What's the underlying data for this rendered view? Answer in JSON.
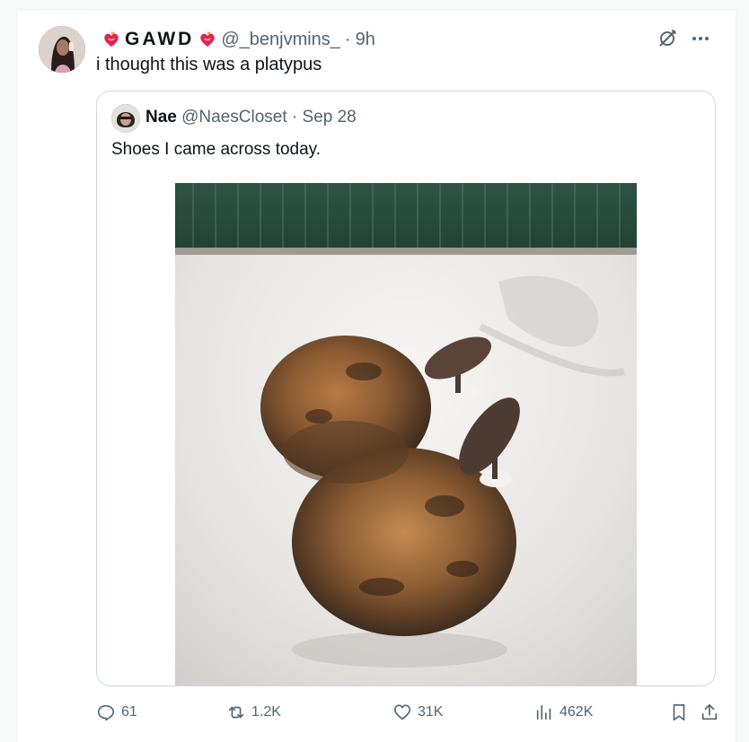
{
  "tweet": {
    "display_name": "GAWD",
    "handle": "@_benjvmins_",
    "dot": "·",
    "time": "9h",
    "text": "i thought this was a platypus"
  },
  "quote": {
    "display_name": "Nae",
    "handle": "@NaesCloset",
    "dot": "·",
    "date": "Sep 28",
    "text": "Shoes I came across today.",
    "photo_icon": "photo-furry-sandals"
  },
  "actions": {
    "replies": "61",
    "reposts": "1.2K",
    "likes": "31K",
    "views": "462K"
  },
  "icons": {
    "grok": "grok-icon",
    "more": "more-icon",
    "reply": "reply-icon",
    "repost": "repost-icon",
    "like": "heart-icon",
    "views": "views-icon",
    "bookmark": "bookmark-icon",
    "share": "share-icon"
  },
  "colors": {
    "text_primary": "#0f1419",
    "text_secondary": "#536471",
    "border": "#cfd9de"
  }
}
